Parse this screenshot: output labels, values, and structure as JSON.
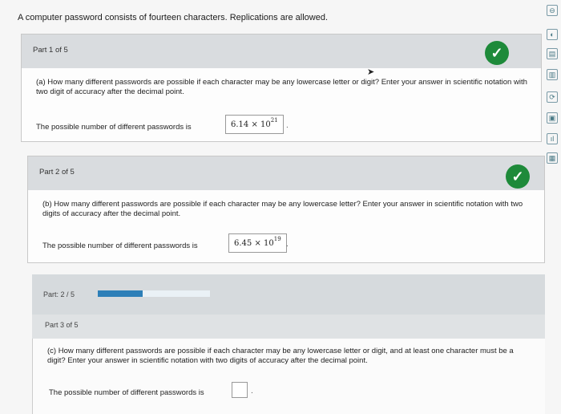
{
  "question": "A computer password consists of fourteen characters. Replications are allowed.",
  "part1": {
    "label": "Part 1 of 5",
    "question": "(a) How many different passwords are possible if each character may be any lowercase letter or digit? Enter your answer in scientific notation with two digit of accuracy after the decimal point.",
    "answer_label": "The possible number of different passwords is",
    "answer_mantissa": "6.14 × 10",
    "answer_exp": "21"
  },
  "part2": {
    "label": "Part 2 of 5",
    "question": "(b) How many different passwords are possible if each character may be any lowercase letter? Enter your answer in scientific notation with two digits of accuracy after the decimal point.",
    "answer_label": "The possible number of different passwords is",
    "answer_mantissa": "6.45 × 10",
    "answer_exp": "19"
  },
  "progress": {
    "label": "Part: 2 / 5",
    "fraction": 0.4
  },
  "part3": {
    "label": "Part 3 of 5",
    "question": "(c) How many different passwords are possible if each character may be any lowercase letter or digit, and at least one character must be a digit? Enter your answer in scientific notation with two digits of accuracy after the decimal point.",
    "answer_label": "The possible number of different passwords is",
    "answer_value": ""
  },
  "icons": {
    "check": "✓",
    "side": [
      "⊖",
      "◐",
      "▤",
      "▥",
      "⟳",
      "▣",
      "ıl",
      "▦"
    ]
  }
}
